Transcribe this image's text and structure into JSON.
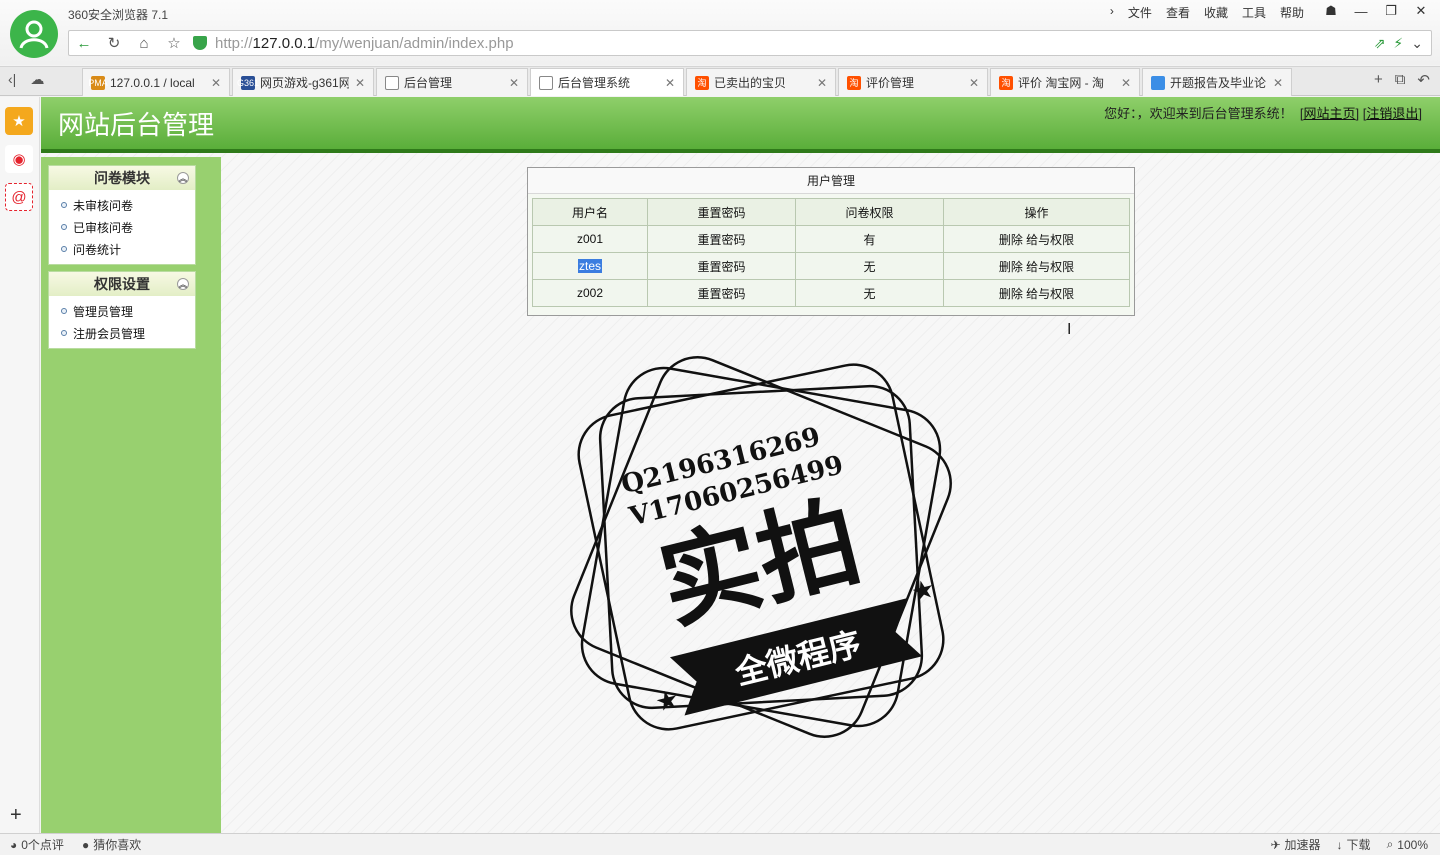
{
  "browser": {
    "app_title": "360安全浏览器 7.1",
    "menu": [
      "文件",
      "查看",
      "收藏",
      "工具",
      "帮助"
    ],
    "window_buttons": [
      "☗",
      "—",
      "❐",
      "✕"
    ],
    "address": {
      "url_prefix": "http://",
      "url_host": "127.0.0.1",
      "url_path": "/my/wenjuan/admin/index.php"
    },
    "tabs": [
      {
        "label": "127.0.0.1 / local",
        "icon": "pma-icon",
        "icon_color": "#d98b18",
        "icon_text": "PMA",
        "active": false
      },
      {
        "label": "网页游戏-g361网",
        "icon": "g361-icon",
        "icon_color": "#2a4f96",
        "icon_text": "G361",
        "active": false
      },
      {
        "label": "后台管理",
        "icon": "page-icon",
        "icon_color": "",
        "icon_text": "",
        "active": false
      },
      {
        "label": "后台管理系统",
        "icon": "page-icon",
        "icon_color": "",
        "icon_text": "",
        "active": true
      },
      {
        "label": "已卖出的宝贝",
        "icon": "taobao-icon",
        "icon_color": "#ff5000",
        "icon_text": "淘",
        "active": false
      },
      {
        "label": "评价管理",
        "icon": "taobao-icon",
        "icon_color": "#ff5000",
        "icon_text": "淘",
        "active": false
      },
      {
        "label": "评价 淘宝网 - 淘",
        "icon": "taobao-icon",
        "icon_color": "#ff5000",
        "icon_text": "淘",
        "active": false
      },
      {
        "label": "开题报告及毕业论",
        "icon": "chrome-icon",
        "icon_color": "#3b8ee6",
        "icon_text": "",
        "active": false
      }
    ]
  },
  "site": {
    "title": "网站后台管理",
    "welcome": "您好：，欢迎来到后台管理系统！",
    "home_link": "网站主页",
    "logout_link": "注销退出"
  },
  "sidebar": {
    "panels": [
      {
        "title": "问卷模块",
        "items": [
          "未审核问卷",
          "已审核问卷",
          "问卷统计"
        ]
      },
      {
        "title": "权限设置",
        "items": [
          "管理员管理",
          "注册会员管理"
        ]
      }
    ]
  },
  "user_management": {
    "title": "用户管理",
    "columns": [
      "用户名",
      "重置密码",
      "问卷权限",
      "操作"
    ],
    "rows": [
      {
        "username": "z001",
        "reset": "重置密码",
        "permission": "有",
        "actions": "删除 给与权限",
        "selected": false
      },
      {
        "username": "ztes",
        "reset": "重置密码",
        "permission": "无",
        "actions": "删除 给与权限",
        "selected": true
      },
      {
        "username": "z002",
        "reset": "重置密码",
        "permission": "无",
        "actions": "删除 给与权限",
        "selected": false
      }
    ]
  },
  "watermark": {
    "line1": "Q2196316269",
    "line2": "V17060256499",
    "main": "实拍",
    "banner": "全微程序"
  },
  "statusbar": {
    "left": [
      "0个点评",
      "猜你喜欢"
    ],
    "right": [
      "加速器",
      "下载",
      "100%"
    ]
  }
}
